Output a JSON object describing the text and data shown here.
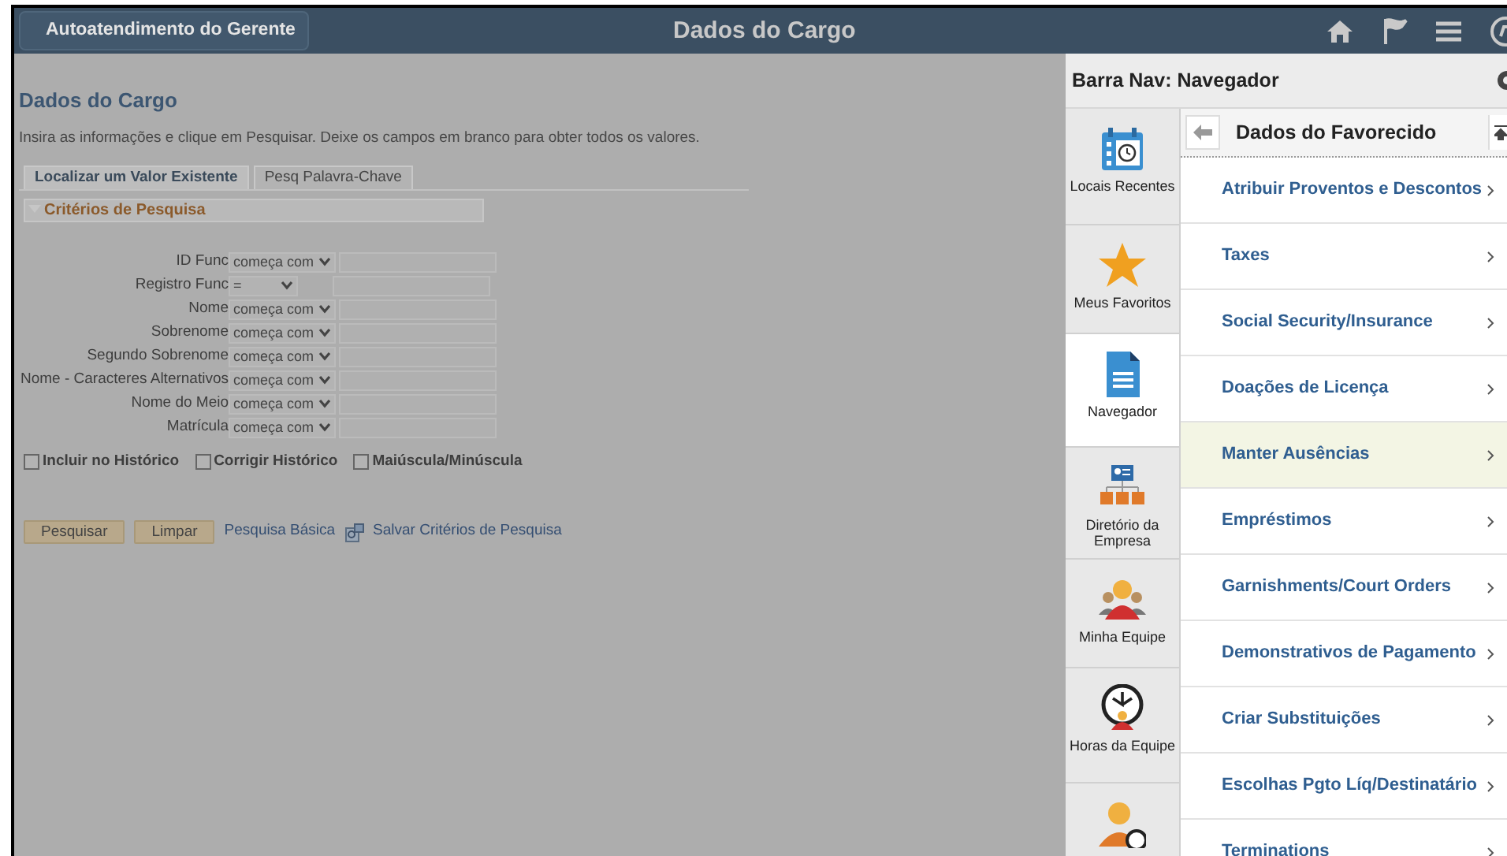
{
  "header": {
    "back_label": "Autoatendimento do Gerente",
    "title": "Dados do Cargo"
  },
  "page": {
    "title": "Dados do Cargo",
    "instructions": "Insira as informações e clique em Pesquisar. Deixe os campos em branco para obter todos os valores.",
    "tabs": [
      {
        "label": "Localizar um Valor Existente",
        "selected": true
      },
      {
        "label": "Pesq Palavra-Chave",
        "selected": false
      }
    ],
    "section": {
      "title": "Critérios de Pesquisa",
      "expanded": true
    },
    "fields": [
      {
        "label": "ID Func",
        "operator": "começa com"
      },
      {
        "label": "Registro Func",
        "operator": "="
      },
      {
        "label": "Nome",
        "operator": "começa com"
      },
      {
        "label": "Sobrenome",
        "operator": "começa com"
      },
      {
        "label": "Segundo Sobrenome",
        "operator": "começa com"
      },
      {
        "label": "Nome - Caracteres Alternativos",
        "operator": "começa com"
      },
      {
        "label": "Nome do Meio",
        "operator": "começa com"
      },
      {
        "label": "Matrícula",
        "operator": "começa com"
      }
    ],
    "checkboxes": [
      {
        "label": "Incluir no Histórico",
        "checked": false
      },
      {
        "label": "Corrigir Histórico",
        "checked": false
      },
      {
        "label": "Maiúscula/Minúscula",
        "checked": false
      }
    ],
    "buttons": [
      "Pesquisar",
      "Limpar"
    ],
    "links": [
      "Pesquisa Básica",
      "Salvar Critérios de Pesquisa"
    ]
  },
  "navbar": {
    "title": "Barra Nav: Navegador",
    "tiles": [
      {
        "kind": "recent",
        "label": "Locais Recentes",
        "selected": false
      },
      {
        "kind": "favorites",
        "label": "Meus Favoritos",
        "selected": false
      },
      {
        "kind": "navigator",
        "label": "Navegador",
        "selected": true
      },
      {
        "kind": "directory",
        "label": "Diretório da Empresa",
        "selected": false
      },
      {
        "kind": "team",
        "label": "Minha Equipe",
        "selected": false
      },
      {
        "kind": "time",
        "label": "Horas da Equipe",
        "selected": false
      },
      {
        "kind": "person",
        "selected": false
      }
    ],
    "folder": "Dados do Favorecido",
    "items": [
      {
        "label": "Atribuir Proventos e Descontos",
        "highlighted": false
      },
      {
        "label": "Taxes",
        "highlighted": false
      },
      {
        "label": "Social Security/Insurance",
        "highlighted": false
      },
      {
        "label": "Doações de Licença",
        "highlighted": false
      },
      {
        "label": "Manter Ausências",
        "highlighted": true
      },
      {
        "label": "Empréstimos",
        "highlighted": false
      },
      {
        "label": "Garnishments/Court Orders",
        "highlighted": false
      },
      {
        "label": "Demonstrativos de Pagamento",
        "highlighted": false
      },
      {
        "label": "Criar Substituições",
        "highlighted": false
      },
      {
        "label": "Escolhas Pgto Líq/Destinatário",
        "highlighted": false
      },
      {
        "label": "Terminations",
        "highlighted": false
      }
    ]
  }
}
